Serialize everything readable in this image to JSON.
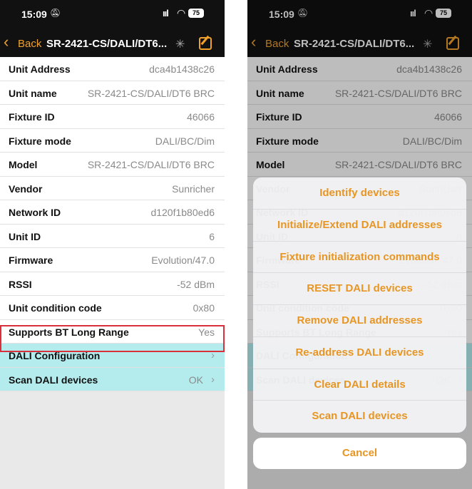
{
  "status_bar": {
    "time": "15:09",
    "battery": "75"
  },
  "nav": {
    "back_label": "Back",
    "title": "SR-2421-CS/DALI/DT6..."
  },
  "details": [
    {
      "label": "Unit Address",
      "value": "dca4b1438c26"
    },
    {
      "label": "Unit name",
      "value": "SR-2421-CS/DALI/DT6 BRC"
    },
    {
      "label": "Fixture ID",
      "value": "46066"
    },
    {
      "label": "Fixture mode",
      "value": "DALI/BC/Dim"
    },
    {
      "label": "Model",
      "value": "SR-2421-CS/DALI/DT6 BRC"
    },
    {
      "label": "Vendor",
      "value": "Sunricher"
    },
    {
      "label": "Network ID",
      "value": "d120f1b80ed6"
    },
    {
      "label": "Unit ID",
      "value": "6"
    },
    {
      "label": "Firmware",
      "value": "Evolution/47.0"
    },
    {
      "label": "RSSI",
      "value": "-52 dBm"
    },
    {
      "label": "Unit condition code",
      "value": "0x80"
    },
    {
      "label": "Supports BT Long Range",
      "value": "Yes"
    }
  ],
  "actions_rows": [
    {
      "label": "DALI Configuration",
      "value": ""
    },
    {
      "label": "Scan DALI devices",
      "value": "OK"
    }
  ],
  "action_sheet": {
    "items": [
      "Identify devices",
      "Initialize/Extend DALI addresses",
      "Fixture initialization commands",
      "RESET DALI devices",
      "Remove DALI addresses",
      "Re-address DALI devices",
      "Clear DALI details",
      "Scan DALI devices"
    ],
    "cancel": "Cancel"
  },
  "colors": {
    "accent": "#f0a12c",
    "highlight_row": "#b4ecee",
    "selection_box": "#d9313b"
  }
}
